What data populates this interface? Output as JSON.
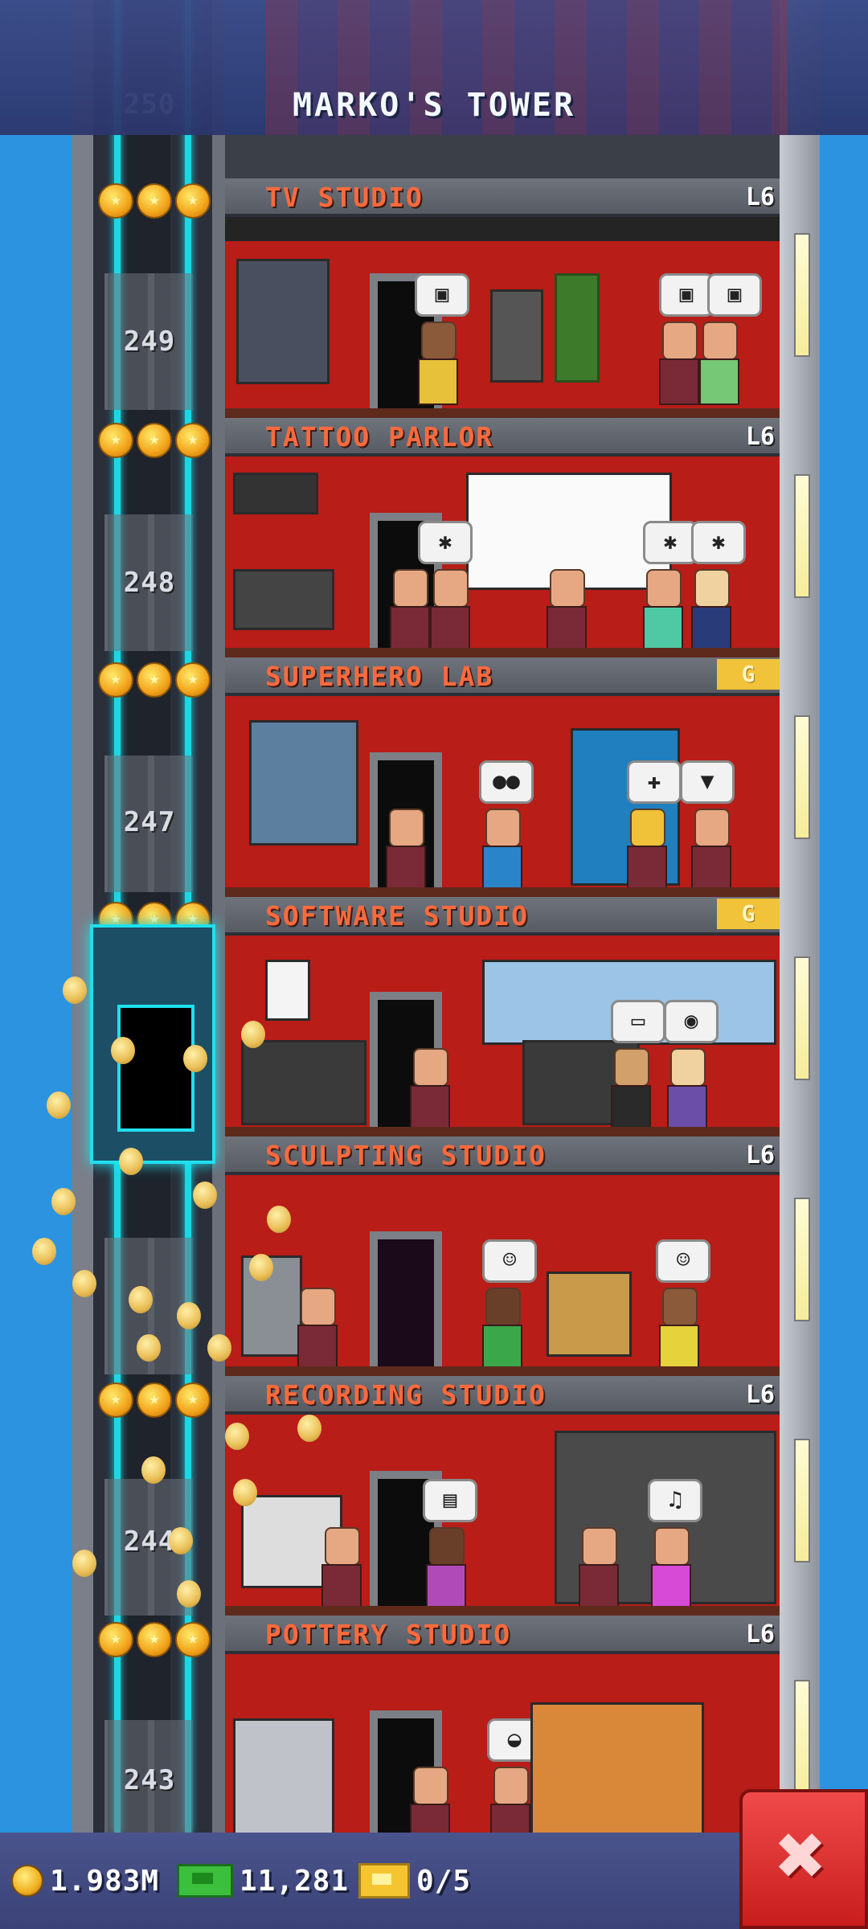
{
  "header": {
    "title": "MARKO'S TOWER",
    "top_floor_number": "250"
  },
  "floors": [
    {
      "name": "TV STUDIO",
      "level": "L6",
      "floor_number": "249",
      "stocked_stars": 3,
      "bubble_icons": [
        "tv-icon",
        "tv-icon",
        "tv-icon"
      ]
    },
    {
      "name": "TATTOO PARLOR",
      "level": "L6",
      "floor_number": "248",
      "stocked_stars": 3,
      "bubble_icons": [
        "spider-icon",
        "spider-icon",
        "spider-icon"
      ]
    },
    {
      "name": "SUPERHERO LAB",
      "level": "G",
      "floor_number": "247",
      "stocked_stars": 3,
      "bubble_icons": [
        "mask-icon",
        "bandage-icon",
        "bat-icon"
      ]
    },
    {
      "name": "SOFTWARE STUDIO",
      "level": "G",
      "floor_number": "",
      "stocked_stars": 3,
      "bubble_icons": [
        "monitor-icon",
        "disc-icon"
      ]
    },
    {
      "name": "SCULPTING STUDIO",
      "level": "L6",
      "floor_number": "",
      "stocked_stars": 0,
      "bubble_icons": [
        "bust-icon",
        "bust-icon"
      ]
    },
    {
      "name": "RECORDING STUDIO",
      "level": "L6",
      "floor_number": "244",
      "stocked_stars": 3,
      "bubble_icons": [
        "picture-icon",
        "music-note-icon"
      ]
    },
    {
      "name": "POTTERY STUDIO",
      "level": "L6",
      "floor_number": "243",
      "stocked_stars": 3,
      "bubble_icons": [
        "pot-icon"
      ]
    }
  ],
  "status": {
    "coins": "1.983M",
    "bux": "11,281",
    "tickets": "0/5"
  },
  "colors": {
    "sky": "#2b93e0",
    "room_red": "#b81d18",
    "floor_name_orange": "#ff6a3d",
    "elevator_cyan": "#19d8e6",
    "close_red": "#e03030"
  }
}
